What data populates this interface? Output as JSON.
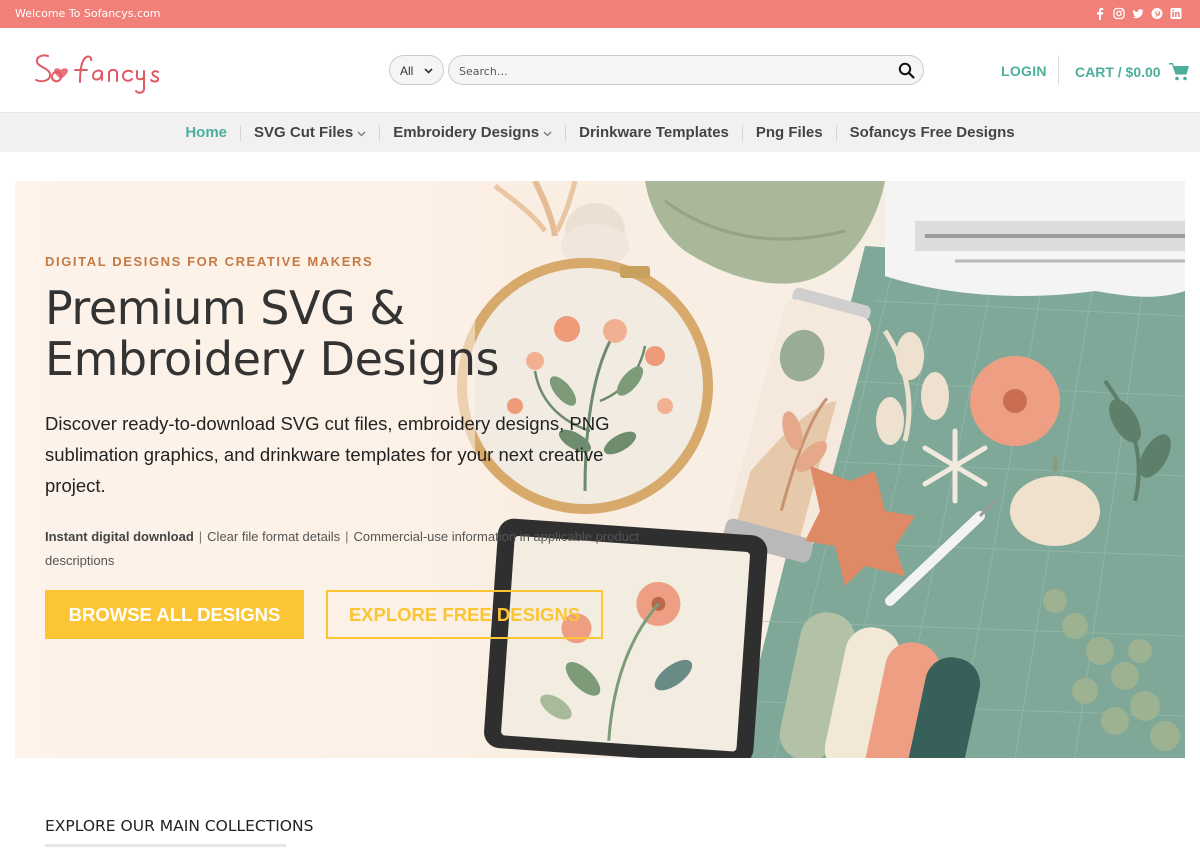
{
  "topbar": {
    "welcome": "Welcome To Sofancys.com",
    "social": [
      "facebook-icon",
      "instagram-icon",
      "twitter-icon",
      "pinterest-icon",
      "linkedin-icon"
    ]
  },
  "header": {
    "logo_text": "Sofancys",
    "category_select": "All",
    "search_placeholder": "Search…",
    "login_label": "LOGIN",
    "cart_label": "CART / $0.00"
  },
  "nav": {
    "items": [
      {
        "label": "Home",
        "dropdown": false,
        "active": true
      },
      {
        "label": "SVG Cut Files",
        "dropdown": true
      },
      {
        "label": "Embroidery Designs",
        "dropdown": true
      },
      {
        "label": "Drinkware Templates",
        "dropdown": false
      },
      {
        "label": "Png Files",
        "dropdown": false
      },
      {
        "label": "Sofancys Free Designs",
        "dropdown": false
      }
    ]
  },
  "hero": {
    "eyebrow": "DIGITAL DESIGNS FOR CREATIVE MAKERS",
    "headline": "Premium SVG & Embroidery Designs",
    "description": "Discover ready-to-download SVG cut files, embroidery designs, PNG sublimation graphics, and drinkware templates for your next creative project.",
    "features": {
      "bold": "Instant digital download",
      "item2": "Clear file format details",
      "item3": "Commercial-use information in applicable product descriptions"
    },
    "primary_button": "BROWSE ALL DESIGNS",
    "secondary_button": "EXPLORE FREE DESIGNS"
  },
  "collections": {
    "title": "EXPLORE OUR MAIN COLLECTIONS"
  },
  "colors": {
    "topbar": "#f08078",
    "accent_green": "#4caf9b",
    "button_yellow": "#fcc535",
    "eyebrow": "#c47a45"
  }
}
